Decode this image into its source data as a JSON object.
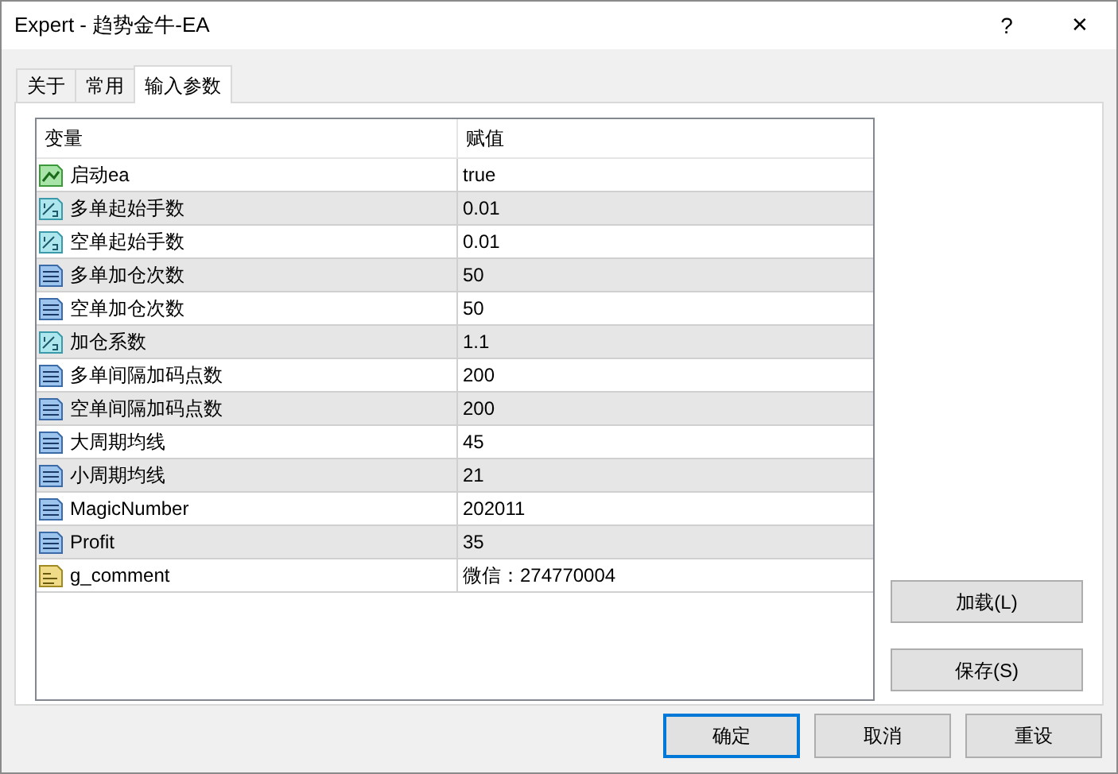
{
  "window": {
    "title": "Expert - 趋势金牛-EA",
    "help": "?",
    "close": "✕"
  },
  "tabs": [
    {
      "label": "关于",
      "selected": false
    },
    {
      "label": "常用",
      "selected": false
    },
    {
      "label": "输入参数",
      "selected": true
    }
  ],
  "table": {
    "columns": [
      "变量",
      "赋值"
    ],
    "rows": [
      {
        "kind": "bool",
        "name": "启动ea",
        "value": "true"
      },
      {
        "kind": "double",
        "name": "多单起始手数",
        "value": "0.01"
      },
      {
        "kind": "double",
        "name": "空单起始手数",
        "value": "0.01"
      },
      {
        "kind": "int",
        "name": "多单加仓次数",
        "value": "50"
      },
      {
        "kind": "int",
        "name": "空单加仓次数",
        "value": "50"
      },
      {
        "kind": "double",
        "name": "加仓系数",
        "value": "1.1"
      },
      {
        "kind": "int",
        "name": "多单间隔加码点数",
        "value": "200"
      },
      {
        "kind": "int",
        "name": "空单间隔加码点数",
        "value": "200"
      },
      {
        "kind": "int",
        "name": "大周期均线",
        "value": "45"
      },
      {
        "kind": "int",
        "name": "小周期均线",
        "value": "21"
      },
      {
        "kind": "int",
        "name": "MagicNumber",
        "value": "202011"
      },
      {
        "kind": "int",
        "name": "Profit",
        "value": "35"
      },
      {
        "kind": "string",
        "name": "g_comment",
        "value": "微信：274770004"
      }
    ]
  },
  "side_buttons": [
    "加载(L)",
    "保存(S)"
  ],
  "buttons": [
    {
      "label": "确定",
      "default": true
    },
    {
      "label": "取消",
      "default": false
    },
    {
      "label": "重设",
      "default": false
    }
  ]
}
